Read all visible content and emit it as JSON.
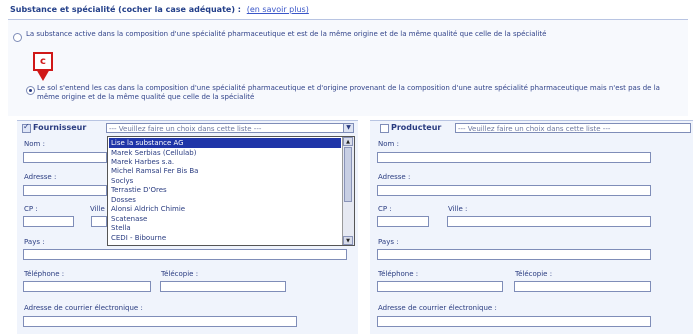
{
  "section": {
    "title": "Substance et spécialité (cocher la case adéquate) :",
    "link": "(en savoir plus)"
  },
  "options": [
    "La substance active dans la composition d'une spécialité pharmaceutique et est de la même origine et de la même qualité que celle de la spécialité",
    "Le sol s'entend les cas dans la composition d'une spécialité pharmaceutique et d'origine provenant de la composition d'une autre spécialité pharmaceutique mais n'est pas de la même origine et de la même qualité que celle de la spécialité"
  ],
  "callout_label": "c",
  "left_panel": {
    "checkbox_label": "Fournisseur",
    "select_value": "--- Veuillez faire un choix dans cette liste ---",
    "labels": {
      "nom": "Nom :",
      "adresse": "Adresse :",
      "cp": "CP :",
      "ville": "Ville :",
      "pays": "Pays :",
      "telephone": "Téléphone :",
      "telecopie": "Télécopie :",
      "email": "Adresse de courrier électronique :"
    }
  },
  "dropdown": {
    "items": [
      "Lise la substance AG",
      "Marek Serbias (Cellulab)",
      "Marek Harbes s.a.",
      "Michel Ramsal Fer Bis Ba",
      "Soclys",
      "Terrastie D'Ores",
      "Dosses",
      "Alonsi Aldrich Chimie",
      "Scatenase",
      "Stella",
      "CEDI - Bibourne"
    ],
    "selected_index": 0
  },
  "right_panel": {
    "checkbox_label": "Producteur",
    "select_value": "--- Veuillez faire un choix dans cette liste ---",
    "labels": {
      "nom": "Nom :",
      "adresse": "Adresse :",
      "cp": "CP :",
      "ville": "Ville :",
      "pays": "Pays :",
      "telephone": "Téléphone :",
      "telecopie": "Télécopie :",
      "email": "Adresse de courrier électronique :"
    }
  },
  "colors": {
    "panel_bg": "#f0f4fc",
    "text": "#2a3c80",
    "selection": "#1f35a8",
    "callout": "#d01818"
  }
}
